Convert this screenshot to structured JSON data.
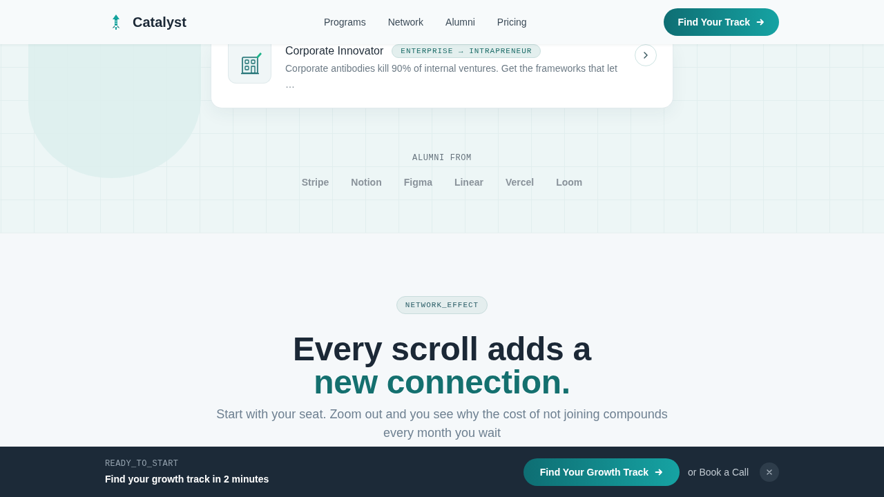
{
  "header": {
    "logo": "Catalyst",
    "nav": [
      {
        "label": "Programs"
      },
      {
        "label": "Network"
      },
      {
        "label": "Alumni"
      },
      {
        "label": "Pricing"
      }
    ],
    "cta": "Find Your Track"
  },
  "card": {
    "title": "Corporate Innovator",
    "tag": "ENTERPRISE → INTRAPRENEUR",
    "description": "Corporate antibodies kill 90% of internal ventures. Get the frameworks that let …"
  },
  "alumni": {
    "label": "ALUMNI FROM",
    "companies": [
      "Stripe",
      "Notion",
      "Figma",
      "Linear",
      "Vercel",
      "Loom"
    ]
  },
  "network_section": {
    "tag": "NETWORK_EFFECT",
    "heading": "Every scroll adds a",
    "heading_highlight": "new connection.",
    "subtitle": "Start with your seat. Zoom out and you see why the cost of not joining compounds every month you wait"
  },
  "bottom_bar": {
    "eyebrow": "READY_TO_START",
    "message": "Find your growth track in 2 minutes",
    "cta": "Find Your Growth Track",
    "secondary_link": "or Book a Call"
  }
}
